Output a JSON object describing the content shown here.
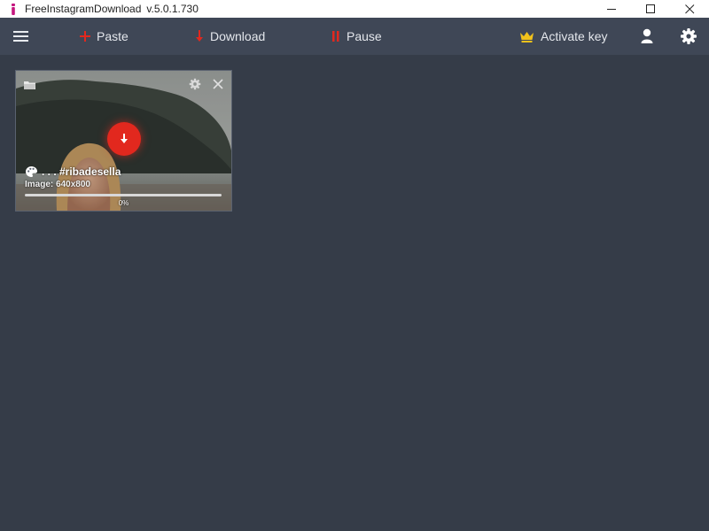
{
  "window": {
    "title": "FreeInstagramDownload",
    "version": "v.5.0.1.730"
  },
  "toolbar": {
    "paste_label": "Paste",
    "download_label": "Download",
    "pause_label": "Pause",
    "activate_label": "Activate key"
  },
  "icons": {
    "menu": "hamburger-icon",
    "paste": "plus-icon",
    "download": "arrow-down-icon",
    "pause": "pause-icon",
    "activate": "crown-icon",
    "user": "user-icon",
    "settings": "gear-icon"
  },
  "colors": {
    "accent_red": "#e2281e",
    "crown_gold": "#f1c21b",
    "toolbar_bg": "#3f4756",
    "content_bg": "#353c48"
  },
  "downloads": [
    {
      "caption": ". . . #ribadesella",
      "info": "Image: 640x800",
      "progress": 0,
      "progress_label": "0%"
    }
  ]
}
